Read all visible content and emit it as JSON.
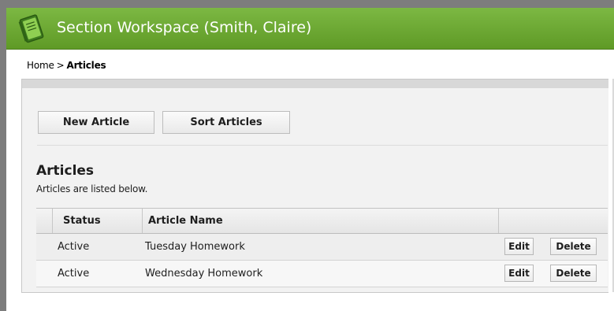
{
  "header": {
    "title": "Section Workspace (Smith, Claire)",
    "icon": "notebook-icon",
    "accent": "#6aa832"
  },
  "breadcrumb": {
    "home": "Home",
    "separator": ">",
    "current": "Articles"
  },
  "toolbar": {
    "new_label": "New Article",
    "sort_label": "Sort Articles"
  },
  "section": {
    "title": "Articles",
    "subtitle": "Articles are listed below."
  },
  "table": {
    "columns": [
      "Status",
      "Article Name"
    ],
    "rows": [
      {
        "status": "Active",
        "name": "Tuesday Homework",
        "edit": "Edit",
        "delete": "Delete"
      },
      {
        "status": "Active",
        "name": "Wednesday Homework",
        "edit": "Edit",
        "delete": "Delete"
      }
    ]
  }
}
